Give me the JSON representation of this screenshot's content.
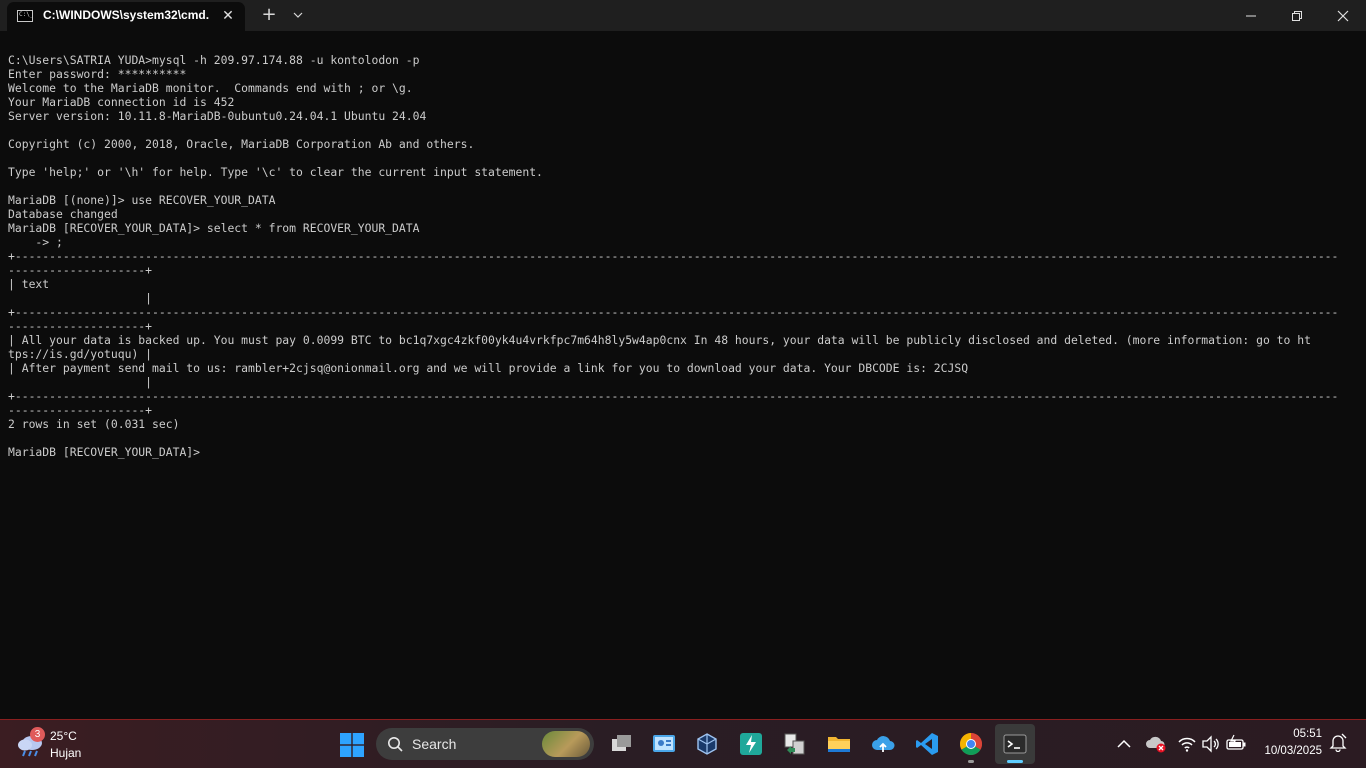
{
  "window": {
    "tab_title": "C:\\WINDOWS\\system32\\cmd.",
    "tab_icon_text": "C:\\_",
    "new_tab_label": "+",
    "dropdown_label": "⌄",
    "close_tab_label": "✕",
    "controls": [
      "minimize",
      "restore",
      "close"
    ]
  },
  "terminal": {
    "lines": [
      "C:\\Users\\SATRIA YUDA>mysql -h 209.97.174.88 -u kontolodon -p",
      "Enter password: **********",
      "Welcome to the MariaDB monitor.  Commands end with ; or \\g.",
      "Your MariaDB connection id is 452",
      "Server version: 10.11.8-MariaDB-0ubuntu0.24.04.1 Ubuntu 24.04",
      "",
      "Copyright (c) 2000, 2018, Oracle, MariaDB Corporation Ab and others.",
      "",
      "Type 'help;' or '\\h' for help. Type '\\c' to clear the current input statement.",
      "",
      "MariaDB [(none)]> use RECOVER_YOUR_DATA",
      "Database changed",
      "MariaDB [RECOVER_YOUR_DATA]> select * from RECOVER_YOUR_DATA",
      "    -> ;",
      "+-------------------------------------------------------------------------------------------------------------------------------------------------------------------------------------------------",
      "--------------------+",
      "| text",
      "                    |",
      "+-------------------------------------------------------------------------------------------------------------------------------------------------------------------------------------------------",
      "--------------------+",
      "| All your data is backed up. You must pay 0.0099 BTC to bc1q7xgc4zkf00yk4u4vrkfpc7m64h8ly5w4ap0cnx In 48 hours, your data will be publicly disclosed and deleted. (more information: go to ht",
      "tps://is.gd/yotuqu) |",
      "| After payment send mail to us: rambler+2cjsq@onionmail.org and we will provide a link for you to download your data. Your DBCODE is: 2CJSQ",
      "                    |",
      "+-------------------------------------------------------------------------------------------------------------------------------------------------------------------------------------------------",
      "--------------------+",
      "2 rows in set (0.031 sec)",
      "",
      "MariaDB [RECOVER_YOUR_DATA]>"
    ]
  },
  "taskbar": {
    "weather": {
      "badge": "3",
      "temperature": "25°C",
      "condition": "Hujan"
    },
    "search_label": "Search",
    "pinned": [
      {
        "name": "task-view-icon"
      },
      {
        "name": "control-panel-icon"
      },
      {
        "name": "virtualbox-icon"
      },
      {
        "name": "speedtest-icon"
      },
      {
        "name": "file-share-icon"
      },
      {
        "name": "file-explorer-icon"
      },
      {
        "name": "cloud-sync-icon"
      },
      {
        "name": "vscode-icon"
      },
      {
        "name": "chrome-icon"
      },
      {
        "name": "terminal-icon"
      }
    ],
    "clock": {
      "time": "05:51",
      "date": "10/03/2025"
    }
  },
  "colors": {
    "terminal_bg": "#0c0c0c",
    "terminal_fg": "#cccccc",
    "titlebar_bg": "#1f1f1f",
    "taskbar_bg": "#3b1d22",
    "accent": "#60cdff"
  }
}
